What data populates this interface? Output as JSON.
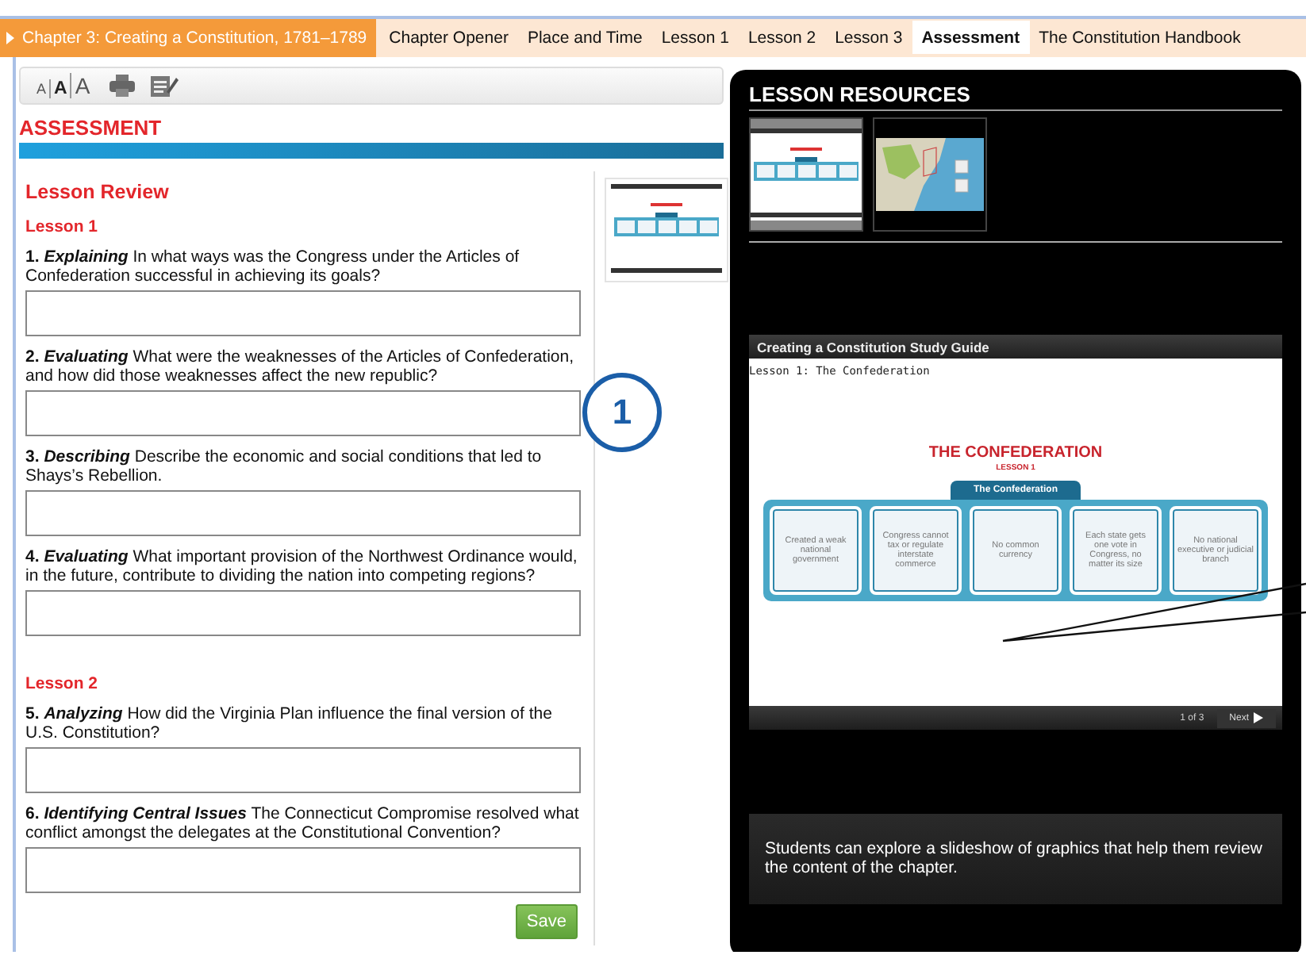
{
  "nav": {
    "chapter": "Chapter 3: Creating a Constitution, 1781–1789",
    "tabs": [
      {
        "label": "Chapter Opener",
        "selected": false
      },
      {
        "label": "Place and Time",
        "selected": false
      },
      {
        "label": "Lesson 1",
        "selected": false
      },
      {
        "label": "Lesson 2",
        "selected": false
      },
      {
        "label": "Lesson 3",
        "selected": false
      },
      {
        "label": "Assessment",
        "selected": true
      },
      {
        "label": "The Constitution Handbook",
        "selected": false
      }
    ]
  },
  "toolbar": {
    "font_sizes": [
      {
        "label": "A",
        "selected": false
      },
      {
        "label": "A",
        "selected": true
      },
      {
        "label": "A",
        "selected": false
      }
    ]
  },
  "assessment": {
    "title": "ASSESSMENT",
    "heading": "Lesson Review",
    "sections": [
      {
        "title": "Lesson 1",
        "questions": [
          {
            "number": "1.",
            "skill": "Explaining",
            "text": "In what ways was the Congress under the Articles of Confederation successful in achieving its goals?"
          },
          {
            "number": "2.",
            "skill": "Evaluating",
            "text": "What were the weaknesses of the Articles of Confederation, and how did those weaknesses affect the new republic?"
          },
          {
            "number": "3.",
            "skill": "Describing",
            "text": "Describe the economic and social conditions that led to Shays’s Rebellion."
          },
          {
            "number": "4.",
            "skill": "Evaluating",
            "text": "What important provision of the Northwest Ordinance would, in the future, contribute to dividing the nation into competing regions?"
          }
        ]
      },
      {
        "title": "Lesson 2",
        "questions": [
          {
            "number": "5.",
            "skill": "Analyzing",
            "text": "How did the Virginia Plan influence the final version of the U.S. Constitution?"
          },
          {
            "number": "6.",
            "skill": "Identifying Central Issues",
            "text": "The Connecticut Compromise resolved what conflict amongst the delegates at the Constitutional Convention?"
          }
        ]
      }
    ],
    "save_button": "Save"
  },
  "callout": {
    "label": "1"
  },
  "resources": {
    "title": "LESSON RESOURCES",
    "thumbnails": [
      {
        "kind": "slide",
        "selected": true
      },
      {
        "kind": "map",
        "selected": false
      }
    ]
  },
  "viewer": {
    "title": "Creating a Constitution Study Guide",
    "slide_title": "Lesson 1: The Confederation",
    "heading": "THE CONFEDERATION",
    "subheading": "LESSON 1",
    "tab": "The Confederation",
    "boxes": [
      "Created a weak national government",
      "Congress cannot tax or regulate interstate commerce",
      "No common currency",
      "Each state gets one vote in Congress, no matter its size",
      "No national executive or judicial branch"
    ],
    "page": "1 of 3",
    "next": "Next"
  },
  "caption": "Students can explore a slideshow of graphics that help them review the content of the chapter."
}
